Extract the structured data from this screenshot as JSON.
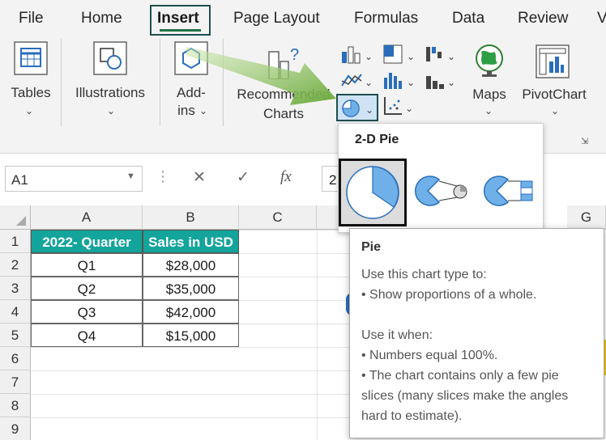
{
  "tabs": [
    "File",
    "Home",
    "Insert",
    "Page Layout",
    "Formulas",
    "Data",
    "Review",
    "V"
  ],
  "active_tab": "Insert",
  "ribbon": {
    "tables": {
      "label": "Tables"
    },
    "illustrations": {
      "label": "Illustrations"
    },
    "addins": {
      "label_line1": "Add-",
      "label_line2": "ins"
    },
    "recommended": {
      "label_line1": "Recommended",
      "label_line2": "Charts"
    },
    "maps": {
      "label": "Maps"
    },
    "pivotchart": {
      "label": "PivotChart"
    }
  },
  "formula_bar": {
    "name_box": "A1",
    "cancel": "✕",
    "confirm": "✓",
    "fx": "fx",
    "content_fragment": "2"
  },
  "grid": {
    "columns": [
      "A",
      "B",
      "C",
      "",
      "",
      "",
      "G"
    ],
    "rows": [
      "1",
      "2",
      "3",
      "4",
      "5",
      "6",
      "7",
      "8",
      "9"
    ],
    "headers": [
      "2022- Quarter",
      "Sales in USD"
    ],
    "data": [
      [
        "Q1",
        "$28,000"
      ],
      [
        "Q2",
        "$35,000"
      ],
      [
        "Q3",
        "$42,000"
      ],
      [
        "Q4",
        "$15,000"
      ]
    ]
  },
  "gallery": {
    "title": "2-D Pie"
  },
  "tooltip": {
    "title": "Pie",
    "line1": "Use this chart type to:",
    "line2": "• Show proportions of a whole.",
    "line3": "Use it when:",
    "line4": "• Numbers equal 100%.",
    "line5": "• The chart contains only a few pie",
    "line6": "slices (many slices make the angles",
    "line7": "hard to estimate)."
  },
  "colors": {
    "accent": "#13a49b",
    "excel_green": "#217346",
    "arrow": "#7ab648",
    "pie_blue": "#6fb0e8"
  }
}
